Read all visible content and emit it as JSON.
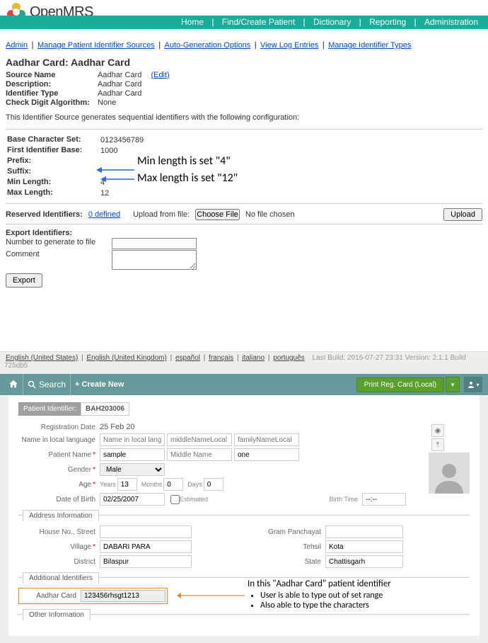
{
  "omrs": {
    "brand": "OpenMRS",
    "nav": {
      "home": "Home",
      "find": "Find/Create Patient",
      "dict": "Dictionary",
      "report": "Reporting",
      "admin": "Administration"
    },
    "crumbs": {
      "admin": "Admin",
      "mpis": "Manage Patient Identifier Sources",
      "ago": "Auto-Generation Options",
      "vle": "View Log Entries",
      "mit": "Manage Identifier Types"
    },
    "title": "Aadhar Card: Aadhar Card",
    "details": {
      "srcname_k": "Source Name",
      "srcname_v": "Aadhar Card",
      "edit": "(Edit)",
      "desc_k": "Description:",
      "desc_v": "Aadhar Card",
      "itype_k": "Identifier Type",
      "itype_v": "Aadhar Card",
      "chk_k": "Check Digit Algorithm:",
      "chk_v": "None"
    },
    "desc_line": "This Identifier Source generates sequential identifiers with the following configuration:",
    "cfg": {
      "base_k": "Base Character Set:",
      "base_v": "0123456789",
      "first_k": "First Identifier Base:",
      "first_v": "1000",
      "prefix_k": "Prefix:",
      "prefix_v": "",
      "suffix_k": "Suffix:",
      "suffix_v": "",
      "min_k": "Min Length:",
      "min_v": "4",
      "max_k": "Max Length:",
      "max_v": "12"
    },
    "annot_min": "Min length is set \"4\"",
    "annot_max": "Max length is set \"12\"",
    "reserved": {
      "lbl": "Reserved Identifiers:",
      "defined": "0 defined",
      "upload_lbl": "Upload from file:",
      "choose": "Choose File",
      "nofile": "No file chosen",
      "upload_btn": "Upload"
    },
    "export": {
      "title": "Export Identifiers:",
      "num_lbl": "Number to generate to file",
      "comment_lbl": "Comment",
      "btn": "Export"
    }
  },
  "locale": {
    "en_us": "English (United States)",
    "en_uk": "English (United Kingdom)",
    "es": "español",
    "fr": "français",
    "it": "italiano",
    "pt": "português",
    "meta": "Last Build: 2016-07-27 23:31   Version: 2.1.1 Build 725db5"
  },
  "bh": {
    "toolbar": {
      "search": "Search",
      "create": "Create New",
      "print": "Print Reg. Card (Local)"
    },
    "pid_lbl": "Patient Identifier:",
    "pid_val": "BAH203006",
    "regdate_lbl": "Registration Date",
    "regdate_val": "25 Feb 20",
    "nll_lbl": "Name in local language",
    "nll_first_ph": "Name in local language",
    "nll_mid_ph": "middleNameLocal",
    "nll_last_ph": "familyNameLocal",
    "pname_lbl": "Patient Name",
    "pname_first": "sample",
    "pname_mid_ph": "Middle Name",
    "pname_last": "one",
    "gender_lbl": "Gender",
    "gender_val": "Male",
    "age_lbl": "Age",
    "age_years_lbl": "Years",
    "age_years": "13",
    "age_months_lbl": "Months",
    "age_months": "0",
    "age_days_lbl": "Days",
    "age_days": "0",
    "dob_lbl": "Date of Birth",
    "dob_val": "02/25/2007",
    "est_lbl": "Estimated",
    "btime_lbl": "Birth Time",
    "btime_val": "--:--",
    "sec_addr": "Address Information",
    "house_lbl": "House No., Street",
    "village_lbl": "Village",
    "village_val": "DABARI PARA",
    "district_lbl": "District",
    "district_val": "Bilaspur",
    "gram_lbl": "Gram Panchayat",
    "tehsil_lbl": "Tehsil",
    "tehsil_val": "Kota",
    "state_lbl": "State",
    "state_val": "Chattisgarh",
    "sec_addl": "Additional Identifiers",
    "aadhar_lbl": "Aadhar Card",
    "aadhar_val": "123456rhsgt1213",
    "sec_other": "Other Information",
    "callout_title": "In this \"Aadhar Card\" patient identifier",
    "callout_b1": "User is able to type out of set range",
    "callout_b2": "Also able to type the characters"
  }
}
